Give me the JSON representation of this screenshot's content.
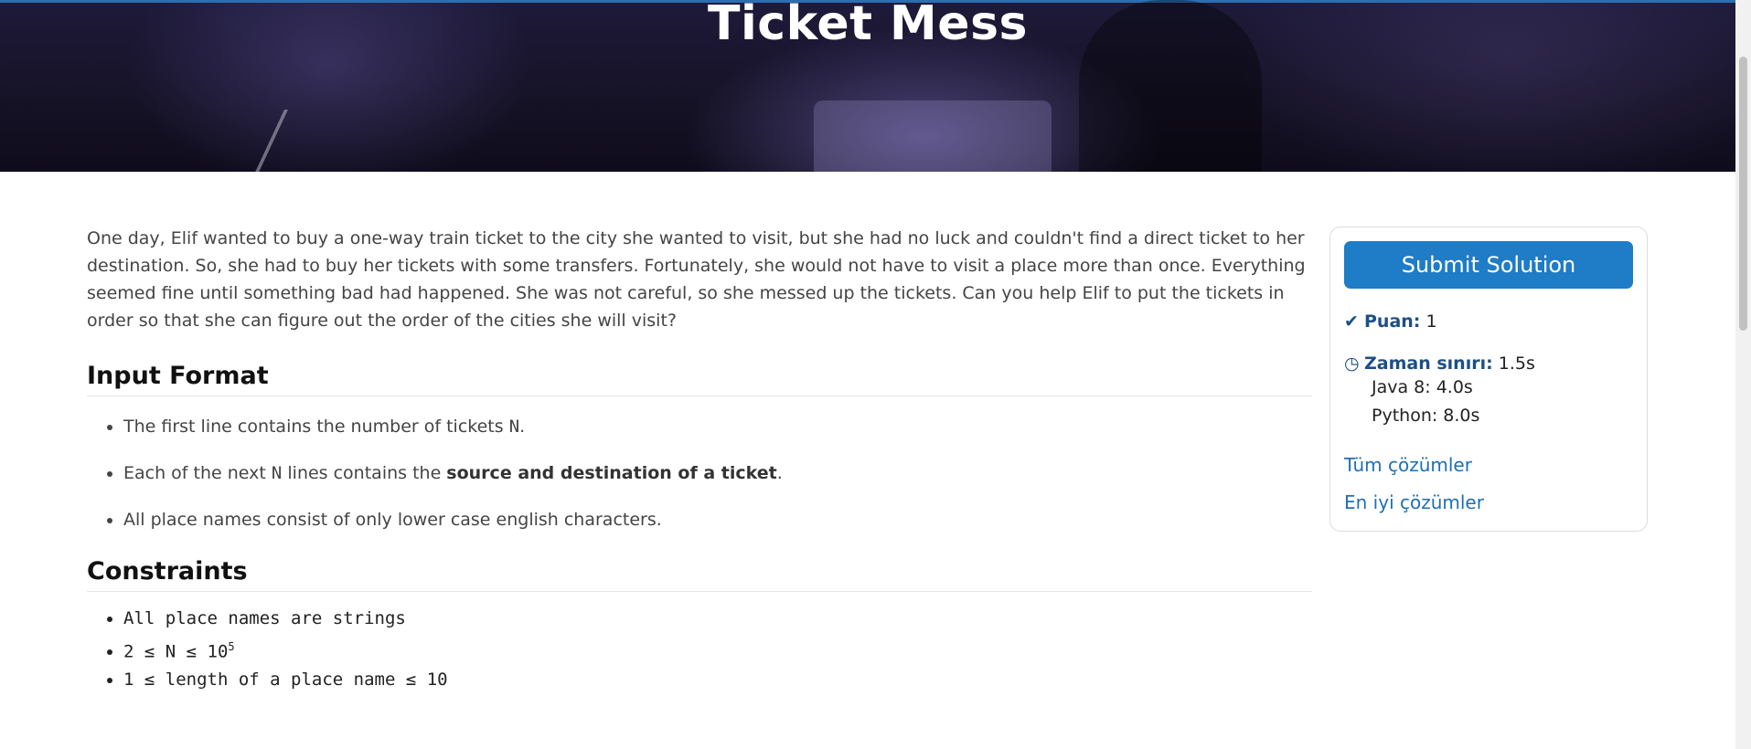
{
  "hero": {
    "title": "Ticket Mess"
  },
  "problem": {
    "description": "One day, Elif wanted to buy a one-way train ticket to the city she wanted to visit, but she had no luck and couldn't find a direct ticket to her destination. So, she had to buy her tickets with some transfers. Fortunately, she would not have to visit a place more than once. Everything seemed fine until something bad had happened. She was not careful, so she messed up the tickets. Can you help Elif to put the tickets in order so that she can figure out the order of the cities she will visit?",
    "input_format": {
      "heading": "Input Format",
      "item1_pre": "The first line contains the number of tickets ",
      "item1_var": "N",
      "item1_post": ".",
      "item2_pre": "Each of the next ",
      "item2_var": "N",
      "item2_mid": " lines contains the ",
      "item2_bold": "source and destination of a ticket",
      "item2_post": ".",
      "item3": "All place names consist of only lower case english characters."
    },
    "constraints": {
      "heading": "Constraints",
      "c1": "All place names are strings",
      "c2_base": "2 ≤ N ≤ 10",
      "c2_sup": "5",
      "c3": "1 ≤ length of a place name ≤ 10"
    }
  },
  "sidebar": {
    "submit_label": "Submit Solution",
    "points_label": "Puan:",
    "points_value": "1",
    "time_label": "Zaman sınırı:",
    "time_value": "1.5s",
    "java_limit": "Java 8: 4.0s",
    "python_limit": "Python: 8.0s",
    "all_solutions": "Tüm çözümler",
    "best_solutions": "En iyi çözümler",
    "check_icon": "✔",
    "clock_icon": "◷"
  },
  "colors": {
    "accent": "#1f7cc6",
    "label": "#1c4f86",
    "link": "#1f6fb5"
  }
}
